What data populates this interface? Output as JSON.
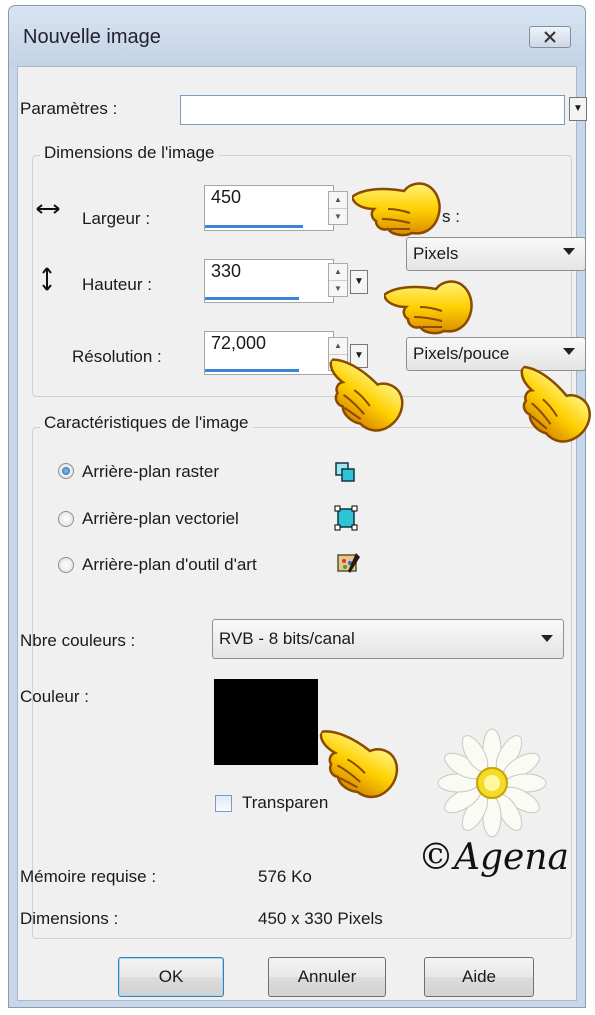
{
  "window": {
    "title": "Nouvelle image"
  },
  "parametres": {
    "label": "Paramètres :",
    "value": ""
  },
  "dimensions": {
    "group_title": "Dimensions de l'image",
    "width_label": "Largeur :",
    "width_value": "450",
    "height_label": "Hauteur :",
    "height_value": "330",
    "resolution_label": "Résolution :",
    "resolution_value": "72,000",
    "units_label": "s :",
    "units_value": "Pixels",
    "resolution_units_value": "Pixels/pouce"
  },
  "characteristics": {
    "group_title": "Caractéristiques de l'image",
    "options": [
      {
        "label": "Arrière-plan raster",
        "selected": true
      },
      {
        "label": "Arrière-plan vectoriel",
        "selected": false
      },
      {
        "label": "Arrière-plan d'outil d'art",
        "selected": false
      }
    ],
    "colors_label": "Nbre couleurs :",
    "colors_value": "RVB - 8 bits/canal",
    "color_label": "Couleur :",
    "color_value": "#000000",
    "transparent_label": "Transparen",
    "memory_label": "Mémoire requise :",
    "memory_value": "576 Ko",
    "dims_label": "Dimensions :",
    "dims_value": "450 x 330 Pixels"
  },
  "buttons": {
    "ok": "OK",
    "cancel": "Annuler",
    "help": "Aide"
  },
  "watermark": "©Agena",
  "icons": [
    "close-icon",
    "width-arrows-icon",
    "height-arrows-icon",
    "raster-layer-icon",
    "vector-layer-icon",
    "art-media-layer-icon",
    "pointing-hand-icon",
    "daisy-flower-icon"
  ]
}
